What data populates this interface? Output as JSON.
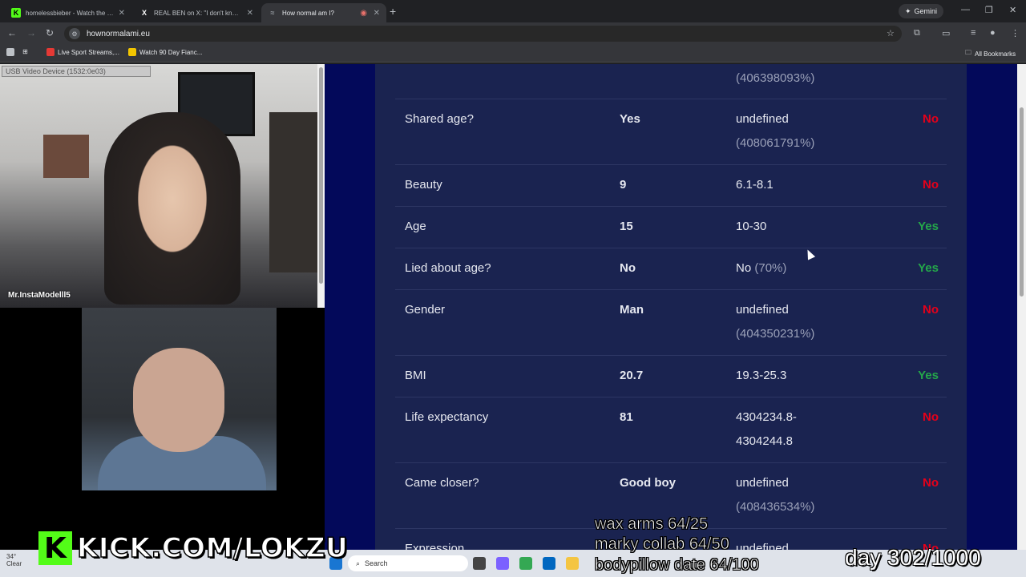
{
  "browser": {
    "tabs": [
      {
        "title": "homelessbieber - Watch the VO",
        "favicon": "K",
        "active": false
      },
      {
        "title": "REAL BEN on X: \"I don't know\"",
        "favicon": "X",
        "active": false
      },
      {
        "title": "How normal am I?",
        "favicon": "◉",
        "active": true
      }
    ],
    "new_tab": "+",
    "gemini_label": "Gemini",
    "url": "hownormalami.eu",
    "bookmarks": [
      {
        "label": "Live Sport Streams,..."
      },
      {
        "label": "Watch 90 Day Fianc..."
      }
    ],
    "all_bookmarks": "All Bookmarks"
  },
  "webcam_top": {
    "device_label": "USB Video Device (1532:0e03)",
    "caption": "Mr.InstaModelll5"
  },
  "results": {
    "rows": [
      {
        "label": "",
        "you": "",
        "normal": "",
        "pct": "(406398093%)",
        "result": "",
        "ok": false
      },
      {
        "label": "Shared age?",
        "you": "Yes",
        "normal": "undefined",
        "pct": "(408061791%)",
        "result": "No",
        "ok": false
      },
      {
        "label": "Beauty",
        "you": "9",
        "normal": "6.1-8.1",
        "pct": "",
        "result": "No",
        "ok": false
      },
      {
        "label": "Age",
        "you": "15",
        "normal": "10-30",
        "pct": "",
        "result": "Yes",
        "ok": true
      },
      {
        "label": "Lied about age?",
        "you": "No",
        "normal": "No",
        "pct": "(70%)",
        "result": "Yes",
        "ok": true
      },
      {
        "label": "Gender",
        "you": "Man",
        "normal": "undefined",
        "pct": "(404350231%)",
        "result": "No",
        "ok": false
      },
      {
        "label": "BMI",
        "you": "20.7",
        "normal": "19.3-25.3",
        "pct": "",
        "result": "Yes",
        "ok": true
      },
      {
        "label": "Life expectancy",
        "you": "81",
        "normal": "4304234.8-",
        "normal2": "4304244.8",
        "pct": "",
        "result": "No",
        "ok": false
      },
      {
        "label": "Came closer?",
        "you": "Good boy",
        "normal": "undefined",
        "pct": "(408436534%)",
        "result": "No",
        "ok": false
      },
      {
        "label": "Expression",
        "you": "",
        "normal": "undefined",
        "pct": "",
        "result": "No",
        "ok": false
      }
    ]
  },
  "taskbar": {
    "search_placeholder": "Search",
    "weather_temp": "34°",
    "weather_text": "Clear"
  },
  "overlay": {
    "kick_text": "KICK.COM/LOKZU",
    "goals": [
      "wax arms 64/25",
      "marky collab 64/50",
      "bodypillow date 64/100"
    ],
    "day": "day 302/1000"
  }
}
